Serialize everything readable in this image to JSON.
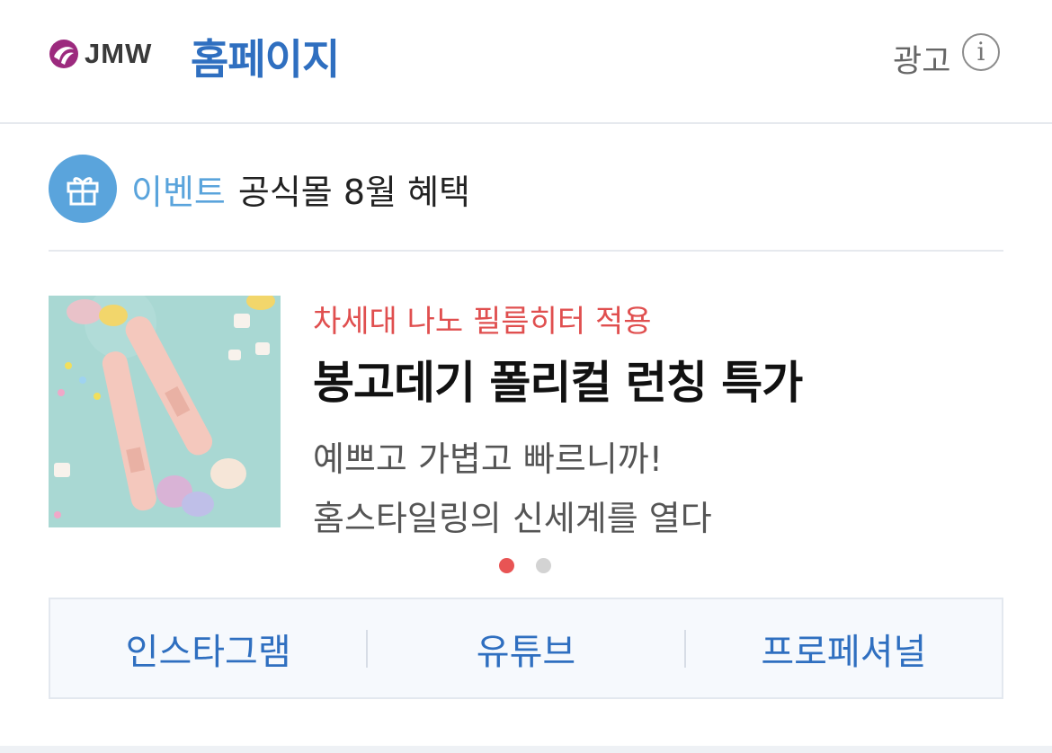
{
  "header": {
    "brand": "JMW",
    "homepage_label": "홈페이지",
    "ad_label": "광고",
    "info_icon": "info-icon"
  },
  "event": {
    "icon": "gift-icon",
    "tag": "이벤트",
    "title": "공식몰 8월 혜택"
  },
  "promo": {
    "subtitle": "차세대 나노 필름히터 적용",
    "title": "봉고데기 폴리컬 런칭 특가",
    "desc_line1": "예쁘고 가볍고 빠르니까!",
    "desc_line2": "홈스타일링의 신세계를 열다",
    "carousel": {
      "current": 1,
      "total": 2
    }
  },
  "links": [
    {
      "label": "인스타그램"
    },
    {
      "label": "유튜브"
    },
    {
      "label": "프로페셔널"
    }
  ],
  "colors": {
    "accent_blue": "#2f6fc0",
    "event_blue": "#5aa4dc",
    "promo_red": "#e04f4f",
    "dot_active": "#e85454"
  }
}
